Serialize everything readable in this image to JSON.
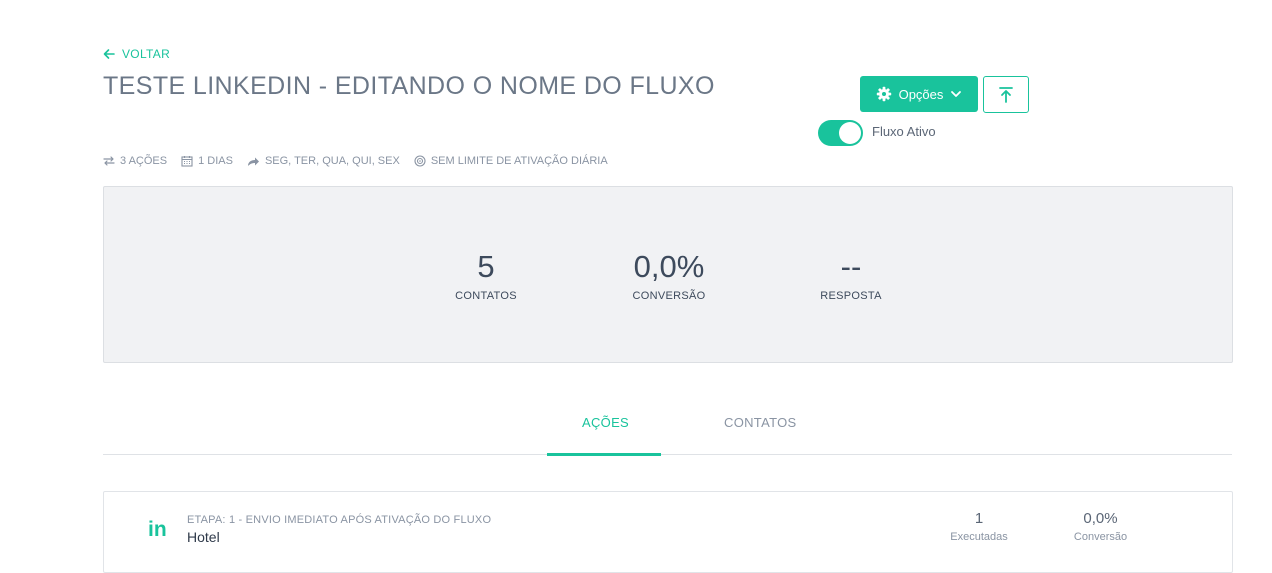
{
  "header": {
    "back_label": "VOLTAR",
    "title": "TESTE LINKEDIN - EDITANDO O NOME DO FLUXO",
    "options_label": "Opções",
    "status_label": "Fluxo Ativo",
    "status_active": true
  },
  "meta": {
    "actions": "3 AÇÕES",
    "days": "1 DIAS",
    "weekdays": "SEG, TER, QUA, QUI, SEX",
    "limit": "SEM LIMITE DE ATIVAÇÃO DIÁRIA"
  },
  "stats": [
    {
      "value": "5",
      "label": "CONTATOS"
    },
    {
      "value": "0,0%",
      "label": "CONVERSÃO"
    },
    {
      "value": "--",
      "label": "RESPOSTA"
    }
  ],
  "tabs": [
    {
      "label": "AÇÕES",
      "active": true
    },
    {
      "label": "CONTATOS",
      "active": false
    }
  ],
  "steps": [
    {
      "icon": "linkedin-icon",
      "icon_text": "in",
      "stage": "ETAPA: 1 - ENVIO IMEDIATO APÓS ATIVAÇÃO DO FLUXO",
      "name": "Hotel",
      "executed_value": "1",
      "executed_label": "Executadas",
      "conversion_value": "0,0%",
      "conversion_label": "Conversão"
    }
  ],
  "colors": {
    "accent": "#19c39c",
    "title": "#6b7787",
    "muted": "#8a94a3",
    "panel": "#f1f2f4"
  }
}
